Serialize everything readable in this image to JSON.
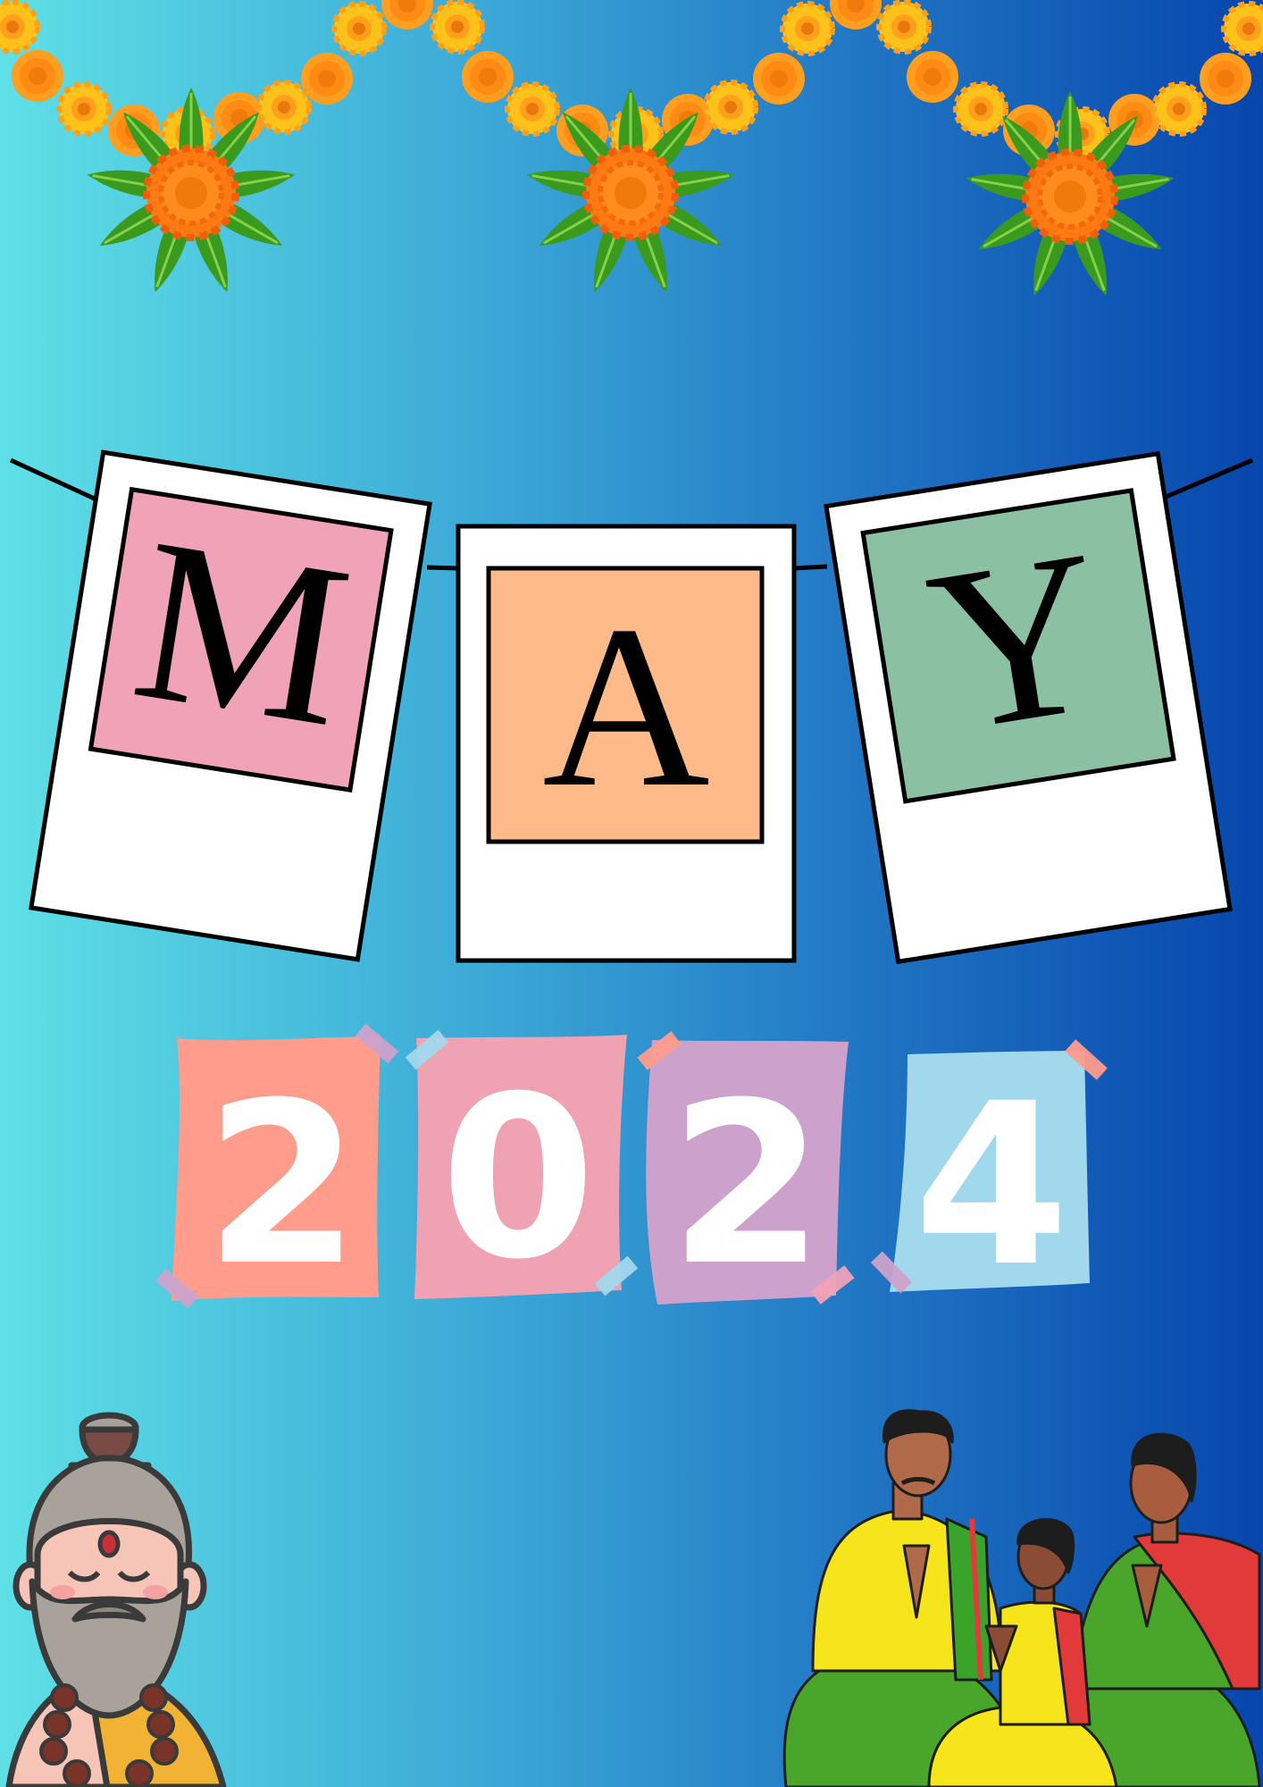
{
  "month": {
    "letters": [
      "M",
      "A",
      "Y"
    ],
    "card_colors": [
      "#f0a2b6",
      "#ffba8a",
      "#8cc0a2"
    ]
  },
  "year": {
    "digits": [
      "2",
      "0",
      "2",
      "4"
    ],
    "card_colors": [
      "#ff9c8c",
      "#eea2b2",
      "#cca2cc",
      "#a2d8ec"
    ]
  },
  "colors": {
    "background_left": "#5fe0e6",
    "background_right": "#0746ad",
    "marigold_orange": "#ff8a1a",
    "marigold_yellow": "#ffc21a",
    "leaf_green": "#3a9a1e"
  },
  "decor": {
    "garland": "marigold-mango-leaf-toran-icon",
    "left_figure": "sage-icon",
    "right_figure": "praying-family-icon"
  }
}
